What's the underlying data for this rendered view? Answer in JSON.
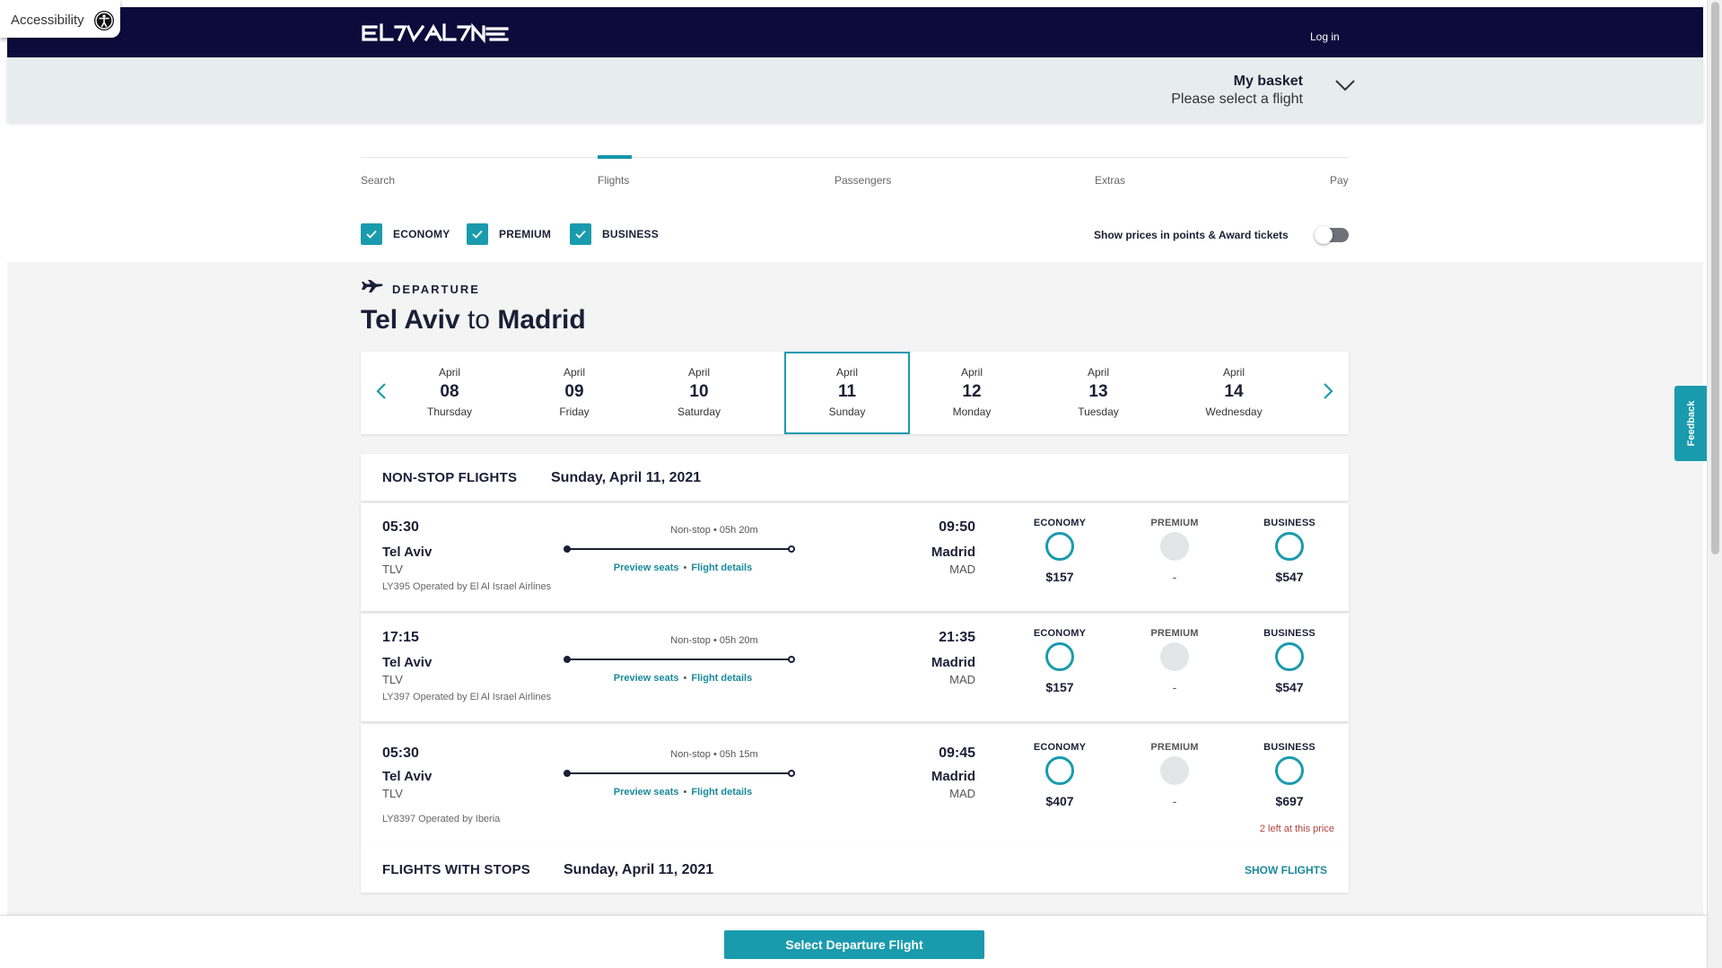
{
  "accessibility": {
    "label": "Accessibility"
  },
  "header": {
    "logo_name": "EL AL",
    "login_label": "Log in"
  },
  "basket": {
    "title": "My basket",
    "subtitle": "Please select a flight"
  },
  "stepper": {
    "steps": [
      "Search",
      "Flights",
      "Passengers",
      "Extras",
      "Pay"
    ],
    "active": "Flights"
  },
  "filters": {
    "economy": "ECONOMY",
    "premium": "PREMIUM",
    "business": "BUSINESS",
    "points_label": "Show prices in points & Award tickets",
    "points_enabled": false
  },
  "departure": {
    "label": "DEPARTURE",
    "from": "Tel Aviv",
    "to_word": "to",
    "to": "Madrid"
  },
  "dates": [
    {
      "month": "April",
      "day": "08",
      "weekday": "Thursday"
    },
    {
      "month": "April",
      "day": "09",
      "weekday": "Friday"
    },
    {
      "month": "April",
      "day": "10",
      "weekday": "Saturday"
    },
    {
      "month": "April",
      "day": "11",
      "weekday": "Sunday",
      "selected": true
    },
    {
      "month": "April",
      "day": "12",
      "weekday": "Monday"
    },
    {
      "month": "April",
      "day": "13",
      "weekday": "Tuesday"
    },
    {
      "month": "April",
      "day": "14",
      "weekday": "Wednesday"
    }
  ],
  "nonstop": {
    "title": "NON-STOP FLIGHTS",
    "date": "Sunday, April 11, 2021"
  },
  "flights": [
    {
      "dep_time": "05:30",
      "dep_city": "Tel Aviv",
      "dep_code": "TLV",
      "operated": "LY395 Operated by El Al Israel Airlines",
      "stops": "Non-stop",
      "duration": "05h 20m",
      "preview_seats": "Preview seats",
      "flight_details": "Flight details",
      "arr_time": "09:50",
      "arr_city": "Madrid",
      "arr_code": "MAD",
      "economy_label": "ECONOMY",
      "economy_price": "$157",
      "premium_label": "PREMIUM",
      "premium_price": "-",
      "business_label": "BUSINESS",
      "business_price": "$547",
      "seats_left": ""
    },
    {
      "dep_time": "17:15",
      "dep_city": "Tel Aviv",
      "dep_code": "TLV",
      "operated": "LY397 Operated by El Al Israel Airlines",
      "stops": "Non-stop",
      "duration": "05h 20m",
      "preview_seats": "Preview seats",
      "flight_details": "Flight details",
      "arr_time": "21:35",
      "arr_city": "Madrid",
      "arr_code": "MAD",
      "economy_label": "ECONOMY",
      "economy_price": "$157",
      "premium_label": "PREMIUM",
      "premium_price": "-",
      "business_label": "BUSINESS",
      "business_price": "$547",
      "seats_left": ""
    },
    {
      "dep_time": "05:30",
      "dep_city": "Tel Aviv",
      "dep_code": "TLV",
      "operated": "LY8397 Operated by Iberia",
      "stops": "Non-stop",
      "duration": "05h 15m",
      "preview_seats": "Preview seats",
      "flight_details": "Flight details",
      "arr_time": "09:45",
      "arr_city": "Madrid",
      "arr_code": "MAD",
      "economy_label": "ECONOMY",
      "economy_price": "$407",
      "premium_label": "PREMIUM",
      "premium_price": "-",
      "business_label": "BUSINESS",
      "business_price": "$697",
      "seats_left": "2 left at this price"
    }
  ],
  "with_stops": {
    "title": "FLIGHTS WITH STOPS",
    "date": "Sunday, April 11, 2021",
    "link": "SHOW FLIGHTS"
  },
  "feedback": {
    "label": "Feedback"
  },
  "footer": {
    "select_button": "Select Departure Flight"
  },
  "colors": {
    "navy": "#0c0b3c",
    "teal": "#1a9bad",
    "link": "#1a8a9b",
    "warning": "#b3423c"
  }
}
